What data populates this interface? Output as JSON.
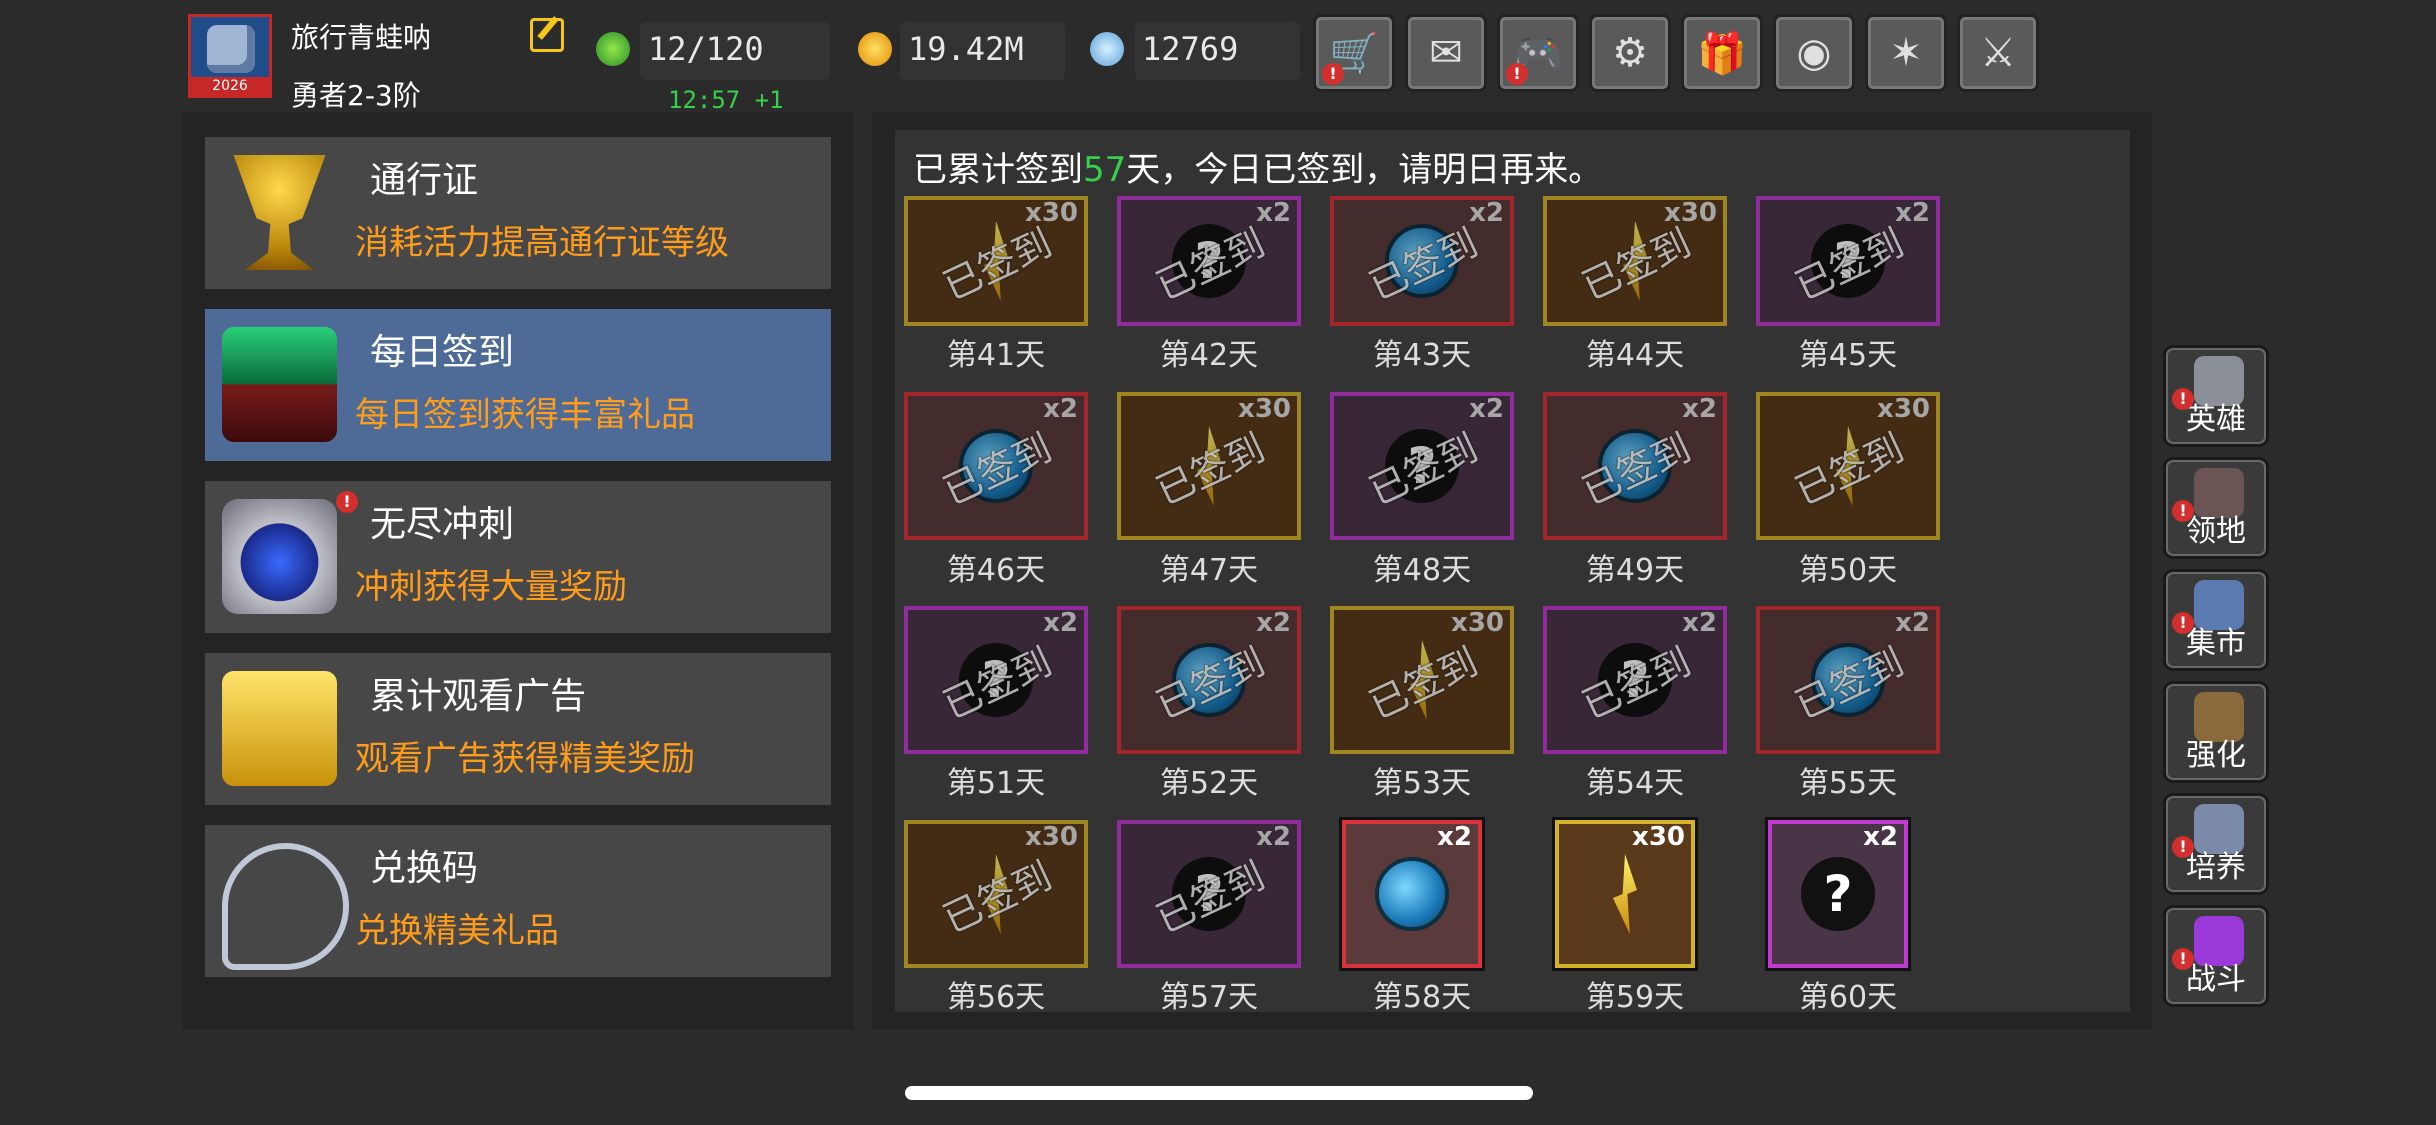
{
  "header": {
    "avatar_year": "2026",
    "player_name": "旅行青蛙呐",
    "player_rank": "勇者2-3阶",
    "energy": "12/120",
    "energy_timer": "12:57 +1",
    "gold": "19.42M",
    "gems": "12769",
    "toolbar": [
      {
        "icon": "shopping-cart-icon",
        "glyph": "🛒",
        "alert": "!"
      },
      {
        "icon": "mail-icon",
        "glyph": "✉",
        "alert": ""
      },
      {
        "icon": "gamepad-icon",
        "glyph": "🎮",
        "alert": "!"
      },
      {
        "icon": "gear-icon",
        "glyph": "⚙",
        "alert": ""
      },
      {
        "icon": "gift-icon",
        "glyph": "🎁",
        "alert": ""
      },
      {
        "icon": "color-wheel-icon",
        "glyph": "◉",
        "alert": ""
      },
      {
        "icon": "fireworks-icon",
        "glyph": "✶",
        "alert": ""
      },
      {
        "icon": "crossed-swords-icon",
        "glyph": "⚔",
        "alert": ""
      }
    ]
  },
  "menu": [
    {
      "title": "通行证",
      "desc": "消耗活力提高通行证等级",
      "icon": "golden-goblet-icon",
      "active": false,
      "alert": ""
    },
    {
      "title": "每日签到",
      "desc": "每日签到获得丰富礼品",
      "icon": "green-chest-icon",
      "active": true,
      "alert": ""
    },
    {
      "title": "无尽冲刺",
      "desc": "冲刺获得大量奖励",
      "icon": "crystal-trophy-icon",
      "active": false,
      "alert": "!"
    },
    {
      "title": "累计观看广告",
      "desc": "观看广告获得精美奖励",
      "icon": "gold-chest-icon",
      "active": false,
      "alert": ""
    },
    {
      "title": "兑换码",
      "desc": "兑换精美礼品",
      "icon": "key-icon",
      "active": false,
      "alert": ""
    }
  ],
  "signin": {
    "notice_prefix": "已累计签到",
    "notice_days": "57",
    "notice_suffix": "天，今日已签到，请明日再来。",
    "stamp_text": "已签到",
    "days": [
      {
        "label": "第41天",
        "item": "shard",
        "mult": "x30",
        "signed": true
      },
      {
        "label": "第42天",
        "item": "mystery",
        "mult": "x2",
        "signed": true
      },
      {
        "label": "第43天",
        "item": "orb",
        "mult": "x2",
        "signed": true
      },
      {
        "label": "第44天",
        "item": "shard",
        "mult": "x30",
        "signed": true
      },
      {
        "label": "第45天",
        "item": "mystery",
        "mult": "x2",
        "signed": true
      },
      {
        "label": "第46天",
        "item": "orb",
        "mult": "x2",
        "signed": true
      },
      {
        "label": "第47天",
        "item": "shard",
        "mult": "x30",
        "signed": true
      },
      {
        "label": "第48天",
        "item": "mystery",
        "mult": "x2",
        "signed": true
      },
      {
        "label": "第49天",
        "item": "orb",
        "mult": "x2",
        "signed": true
      },
      {
        "label": "第50天",
        "item": "shard",
        "mult": "x30",
        "signed": true
      },
      {
        "label": "第51天",
        "item": "mystery",
        "mult": "x2",
        "signed": true
      },
      {
        "label": "第52天",
        "item": "orb",
        "mult": "x2",
        "signed": true
      },
      {
        "label": "第53天",
        "item": "shard",
        "mult": "x30",
        "signed": true
      },
      {
        "label": "第54天",
        "item": "mystery",
        "mult": "x2",
        "signed": true
      },
      {
        "label": "第55天",
        "item": "orb",
        "mult": "x2",
        "signed": true
      },
      {
        "label": "第56天",
        "item": "shard",
        "mult": "x30",
        "signed": true
      },
      {
        "label": "第57天",
        "item": "mystery",
        "mult": "x2",
        "signed": true
      },
      {
        "label": "第58天",
        "item": "orb",
        "mult": "x2",
        "signed": false
      },
      {
        "label": "第59天",
        "item": "shard",
        "mult": "x30",
        "signed": false
      },
      {
        "label": "第60天",
        "item": "mystery",
        "mult": "x2",
        "signed": false
      }
    ]
  },
  "item_colors": {
    "shard": {
      "border": "#d4b22a",
      "bg": "#5a3a1a"
    },
    "orb": {
      "border": "#d8323a",
      "bg": "#5a3a3a"
    },
    "mystery": {
      "border": "#c03ad0",
      "bg": "#4a3448"
    }
  },
  "side_nav": [
    {
      "label": "英雄",
      "icon": "helmet-icon",
      "color": "#8a8f98",
      "alert": "!"
    },
    {
      "label": "领地",
      "icon": "castle-icon",
      "color": "#6b5454",
      "alert": "!"
    },
    {
      "label": "集市",
      "icon": "market-icon",
      "color": "#5a7ab0",
      "alert": "!"
    },
    {
      "label": "强化",
      "icon": "forge-crystal-icon",
      "color": "#8a6a3a",
      "alert": ""
    },
    {
      "label": "培养",
      "icon": "chalice-icon",
      "color": "#7a8aa8",
      "alert": "!"
    },
    {
      "label": "战斗",
      "icon": "purple-portal-icon",
      "color": "#9a3ad8",
      "alert": "!"
    }
  ]
}
